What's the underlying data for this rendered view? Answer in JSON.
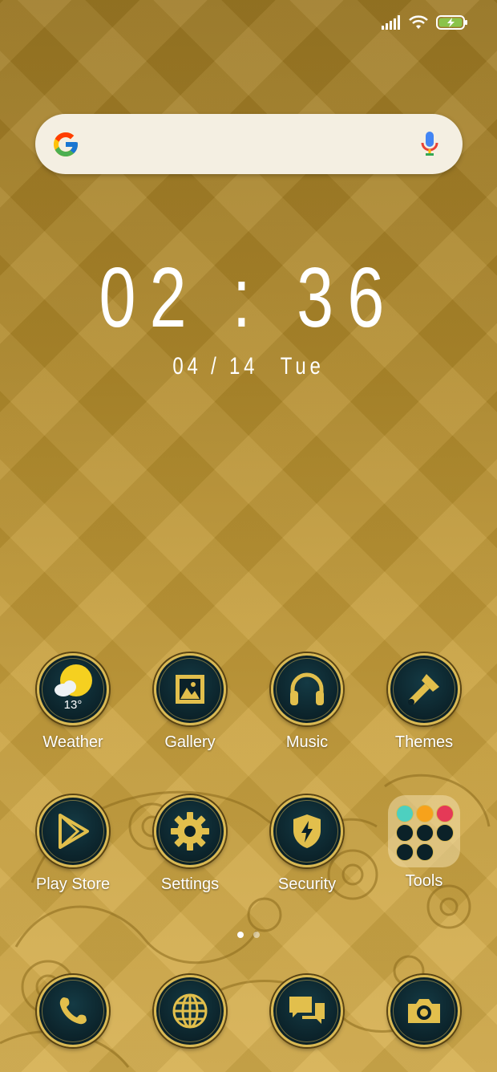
{
  "status_bar": {
    "signal_icon": "signal-bars-icon",
    "wifi_icon": "wifi-icon",
    "battery_icon": "battery-charging-icon",
    "battery_color": "#8bc34a"
  },
  "search": {
    "logo_icon": "google-g-icon",
    "mic_icon": "microphone-icon"
  },
  "clock": {
    "time": "02 : 36",
    "date": "04 / 14",
    "weekday": "Tue"
  },
  "apps_row1": [
    {
      "label": "Weather",
      "icon": "weather-sun-cloud-icon",
      "temp": "13°"
    },
    {
      "label": "Gallery",
      "icon": "gallery-image-icon"
    },
    {
      "label": "Music",
      "icon": "headphones-icon"
    },
    {
      "label": "Themes",
      "icon": "paintbrush-icon"
    }
  ],
  "apps_row2": [
    {
      "label": "Play Store",
      "icon": "play-store-icon"
    },
    {
      "label": "Settings",
      "icon": "gear-icon"
    },
    {
      "label": "Security",
      "icon": "shield-bolt-icon"
    },
    {
      "label": "Tools",
      "icon": "folder-icon"
    }
  ],
  "dock": [
    {
      "icon": "phone-icon"
    },
    {
      "icon": "globe-icon"
    },
    {
      "icon": "messages-icon"
    },
    {
      "icon": "camera-icon"
    }
  ],
  "pages": {
    "count": 2,
    "active": 1
  },
  "theme": {
    "accent": "#d9b954",
    "icon_bg": "#0b2128",
    "icon_gold": "#e2bf4c"
  }
}
